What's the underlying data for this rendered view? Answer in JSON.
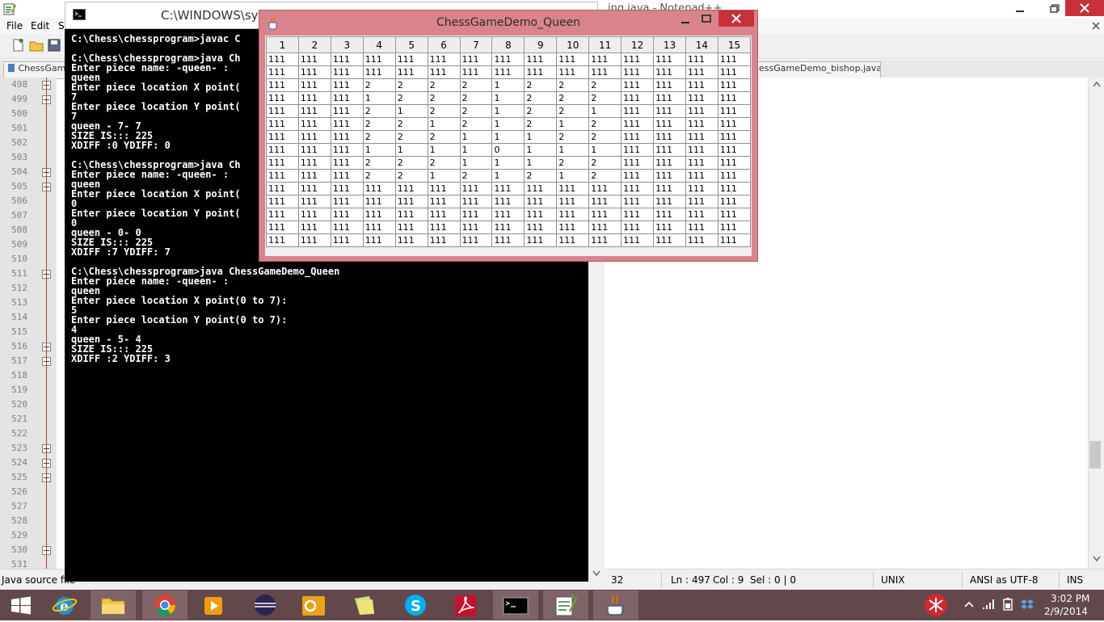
{
  "notepad": {
    "title": "ing.java - Notepad++",
    "menu": [
      "File",
      "Edit",
      "S"
    ],
    "tabs": [
      "ChessGame",
      "essGameDemo_bishop.java"
    ],
    "line_numbers": [
      "498",
      "499",
      "500",
      "501",
      "502",
      "503",
      "504",
      "505",
      "506",
      "507",
      "508",
      "509",
      "510",
      "511",
      "512",
      "513",
      "514",
      "515",
      "516",
      "517",
      "518",
      "519",
      "520",
      "521",
      "522",
      "523",
      "524",
      "525",
      "526",
      "527",
      "528",
      "529",
      "530",
      "531"
    ],
    "fold_rows": [
      0,
      1,
      6,
      7,
      13,
      18,
      19,
      25,
      26,
      27,
      32
    ],
    "status": {
      "file_type": "Java source file",
      "length": "32",
      "ln": "Ln : 497",
      "col": "Col : 9",
      "sel": "Sel : 0 | 0",
      "eol": "UNIX",
      "encoding": "ANSI as UTF-8",
      "mode": "INS"
    }
  },
  "console": {
    "title": "C:\\WINDOWS\\syst",
    "text": "C:\\Chess\\chessprogram>javac C\n\nC:\\Chess\\chessprogram>java Ch\nEnter piece name: -queen- :\nqueen\nEnter piece location X point(\n7\nEnter piece location Y point(\n7\nqueen - 7- 7\nSIZE IS::: 225\nXDIFF :0 YDIFF: 0\n\nC:\\Chess\\chessprogram>java Ch\nEnter piece name: -queen- :\nqueen\nEnter piece location X point(\n0\nEnter piece location Y point(\n0\nqueen - 0- 0\nSIZE IS::: 225\nXDIFF :7 YDIFF: 7\n\nC:\\Chess\\chessprogram>java ChessGameDemo_Queen\nEnter piece name: -queen- :\nqueen\nEnter piece location X point(0 to 7):\n5\nEnter piece location Y point(0 to 7):\n4\nqueen - 5- 4\nSIZE IS::: 225\nXDIFF :2 YDIFF: 3"
  },
  "jframe": {
    "title": "ChessGameDemo_Queen",
    "headers": [
      "1",
      "2",
      "3",
      "4",
      "5",
      "6",
      "7",
      "8",
      "9",
      "10",
      "11",
      "12",
      "13",
      "14",
      "15"
    ],
    "rows": [
      [
        "111",
        "111",
        "111",
        "111",
        "111",
        "111",
        "111",
        "111",
        "111",
        "111",
        "111",
        "111",
        "111",
        "111",
        "111"
      ],
      [
        "111",
        "111",
        "111",
        "111",
        "111",
        "111",
        "111",
        "111",
        "111",
        "111",
        "111",
        "111",
        "111",
        "111",
        "111"
      ],
      [
        "111",
        "111",
        "111",
        "2",
        "2",
        "2",
        "2",
        "1",
        "2",
        "2",
        "2",
        "111",
        "111",
        "111",
        "111"
      ],
      [
        "111",
        "111",
        "111",
        "1",
        "2",
        "2",
        "2",
        "1",
        "2",
        "2",
        "2",
        "111",
        "111",
        "111",
        "111"
      ],
      [
        "111",
        "111",
        "111",
        "2",
        "1",
        "2",
        "2",
        "1",
        "2",
        "2",
        "1",
        "111",
        "111",
        "111",
        "111"
      ],
      [
        "111",
        "111",
        "111",
        "2",
        "2",
        "1",
        "2",
        "1",
        "2",
        "1",
        "2",
        "111",
        "111",
        "111",
        "111"
      ],
      [
        "111",
        "111",
        "111",
        "2",
        "2",
        "2",
        "1",
        "1",
        "1",
        "2",
        "2",
        "111",
        "111",
        "111",
        "111"
      ],
      [
        "111",
        "111",
        "111",
        "1",
        "1",
        "1",
        "1",
        "0",
        "1",
        "1",
        "1",
        "111",
        "111",
        "111",
        "111"
      ],
      [
        "111",
        "111",
        "111",
        "2",
        "2",
        "2",
        "1",
        "1",
        "1",
        "2",
        "2",
        "111",
        "111",
        "111",
        "111"
      ],
      [
        "111",
        "111",
        "111",
        "2",
        "2",
        "1",
        "2",
        "1",
        "2",
        "1",
        "2",
        "111",
        "111",
        "111",
        "111"
      ],
      [
        "111",
        "111",
        "111",
        "111",
        "111",
        "111",
        "111",
        "111",
        "111",
        "111",
        "111",
        "111",
        "111",
        "111",
        "111"
      ],
      [
        "111",
        "111",
        "111",
        "111",
        "111",
        "111",
        "111",
        "111",
        "111",
        "111",
        "111",
        "111",
        "111",
        "111",
        "111"
      ],
      [
        "111",
        "111",
        "111",
        "111",
        "111",
        "111",
        "111",
        "111",
        "111",
        "111",
        "111",
        "111",
        "111",
        "111",
        "111"
      ],
      [
        "111",
        "111",
        "111",
        "111",
        "111",
        "111",
        "111",
        "111",
        "111",
        "111",
        "111",
        "111",
        "111",
        "111",
        "111"
      ],
      [
        "111",
        "111",
        "111",
        "111",
        "111",
        "111",
        "111",
        "111",
        "111",
        "111",
        "111",
        "111",
        "111",
        "111",
        "111"
      ]
    ]
  },
  "taskbar": {
    "apps": [
      "start-icon",
      "ie-icon",
      "file-explorer-icon",
      "chrome-icon",
      "media-player-icon",
      "eclipse-icon",
      "outlook-icon",
      "sticky-notes-icon",
      "skype-icon",
      "acrobat-icon",
      "cmd-icon",
      "notepadpp-icon",
      "java-icon"
    ],
    "time": "3:02 PM",
    "date": "2/9/2014"
  },
  "colors": {
    "frame_accent": "#d9848c",
    "close_red": "#c7323a",
    "taskbar_bg": "#62484a"
  }
}
